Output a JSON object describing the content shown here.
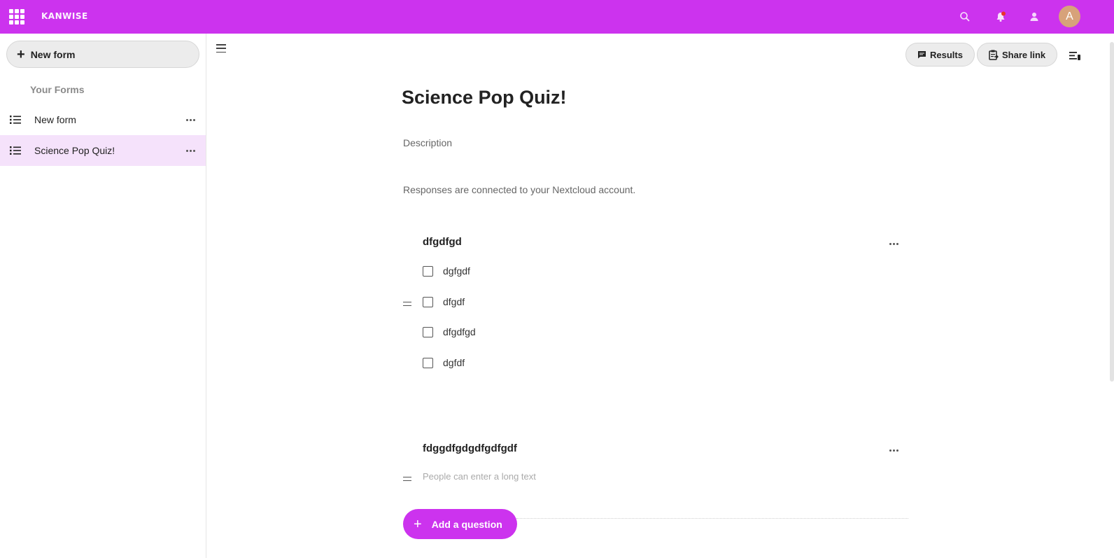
{
  "header": {
    "logo_text": "KANWISE",
    "icons": [
      "apps-icon",
      "search-icon",
      "notifications-icon",
      "contacts-icon"
    ],
    "avatar_initial": "A",
    "brand_color": "#cc33ee"
  },
  "sidebar": {
    "new_form_label": "New form",
    "caption": "Your Forms",
    "items": [
      {
        "label": "New form",
        "active": false
      },
      {
        "label": "Science Pop Quiz!",
        "active": true
      }
    ]
  },
  "toolbar": {
    "results_label": "Results",
    "share_label": "Share link"
  },
  "form": {
    "title": "Science Pop Quiz!",
    "description_placeholder": "Description",
    "info": "Responses are connected to your Nextcloud account.",
    "questions": [
      {
        "title": "dfgdfgd",
        "type": "checkbox",
        "options": [
          "dgfgdf",
          "dfgdf",
          "dfgdfgd",
          "dgfdf"
        ]
      },
      {
        "title": "fdggdfgdgdfgdfgdf",
        "type": "long-text",
        "placeholder": "People can enter a long text"
      }
    ],
    "add_question_label": "Add a question"
  }
}
